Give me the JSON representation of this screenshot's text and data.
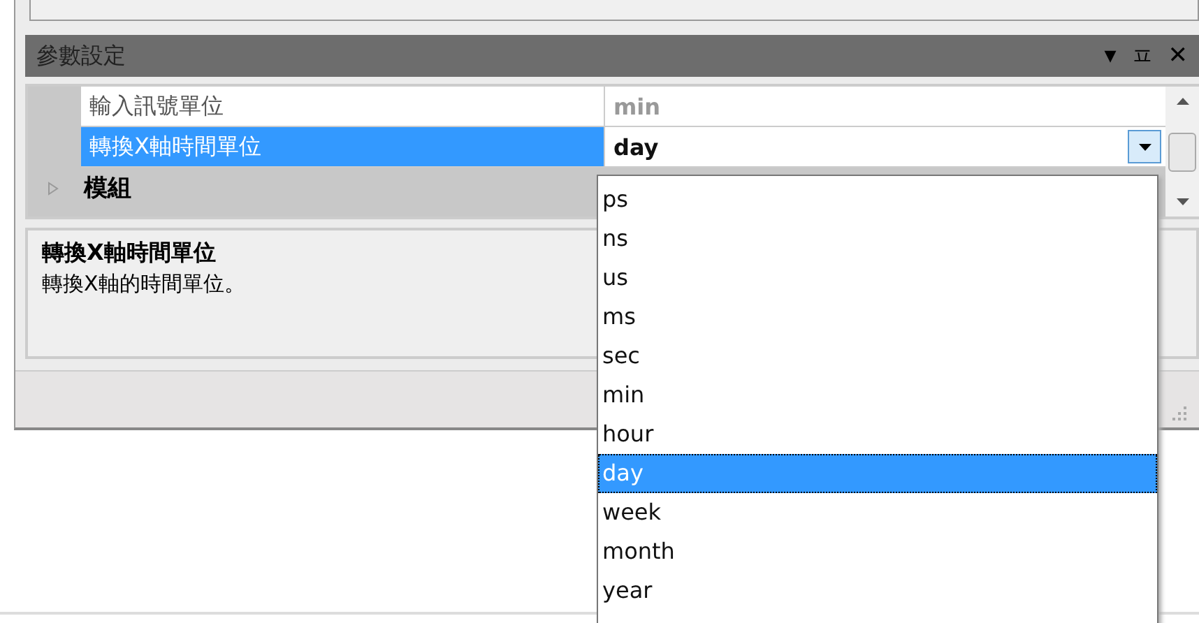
{
  "panel": {
    "title": "參數設定",
    "buttons": [
      "▾",
      "ㅍ",
      "✕"
    ]
  },
  "properties": [
    {
      "name": "輸入訊號單位",
      "value": "min",
      "selected": false,
      "disabled": true
    },
    {
      "name": "轉換X軸時間單位",
      "value": "day",
      "selected": true,
      "disabled": false
    }
  ],
  "category": {
    "name": "模組",
    "expanded": false
  },
  "description": {
    "title": "轉換X軸時間單位",
    "text": "轉換X軸的時間單位。"
  },
  "dropdown": {
    "options": [
      {
        "label": "ps",
        "selected": false
      },
      {
        "label": "ns",
        "selected": false
      },
      {
        "label": "us",
        "selected": false
      },
      {
        "label": "ms",
        "selected": false
      },
      {
        "label": "sec",
        "selected": false
      },
      {
        "label": "min",
        "selected": false
      },
      {
        "label": "hour",
        "selected": false
      },
      {
        "label": "day",
        "selected": true
      },
      {
        "label": "week",
        "selected": false
      },
      {
        "label": "month",
        "selected": false
      },
      {
        "label": "year",
        "selected": false
      }
    ]
  }
}
